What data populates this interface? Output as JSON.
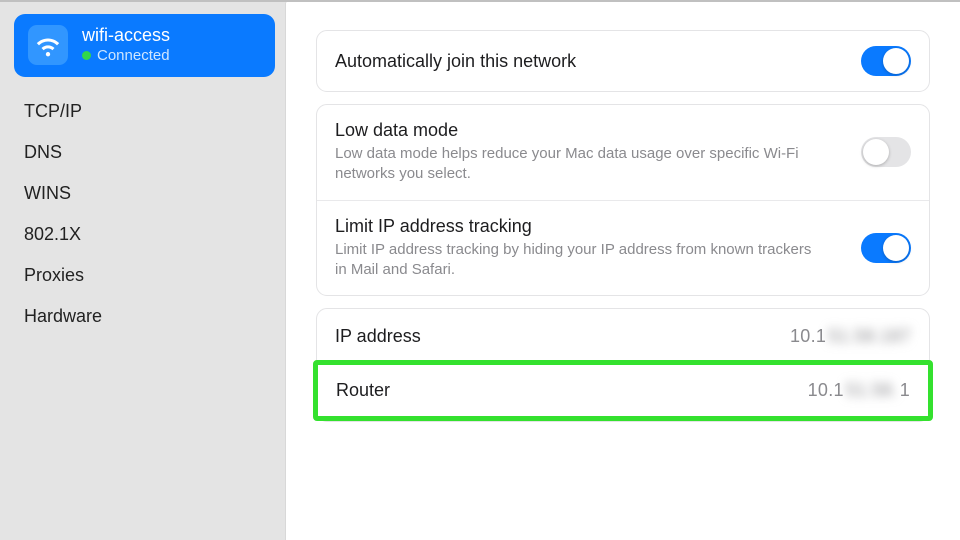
{
  "sidebar": {
    "network": {
      "ssid": "wifi-access",
      "status": "Connected"
    },
    "items": [
      {
        "label": "TCP/IP"
      },
      {
        "label": "DNS"
      },
      {
        "label": "WINS"
      },
      {
        "label": "802.1X"
      },
      {
        "label": "Proxies"
      },
      {
        "label": "Hardware"
      }
    ]
  },
  "settings": {
    "auto_join": {
      "label": "Automatically join this network",
      "on": true
    },
    "low_data": {
      "label": "Low data mode",
      "desc": "Low data mode helps reduce your Mac data usage over specific Wi-Fi networks you select.",
      "on": false
    },
    "limit_ip": {
      "label": "Limit IP address tracking",
      "desc": "Limit IP address tracking by hiding your IP address from known trackers in Mail and Safari.",
      "on": true
    },
    "ip_row": {
      "label": "IP address",
      "prefix": "10.1",
      "hidden": "51.58.187"
    },
    "router_row": {
      "label": "Router",
      "prefix": "10.1",
      "hidden": "51.58.",
      "suffix": "1"
    }
  }
}
